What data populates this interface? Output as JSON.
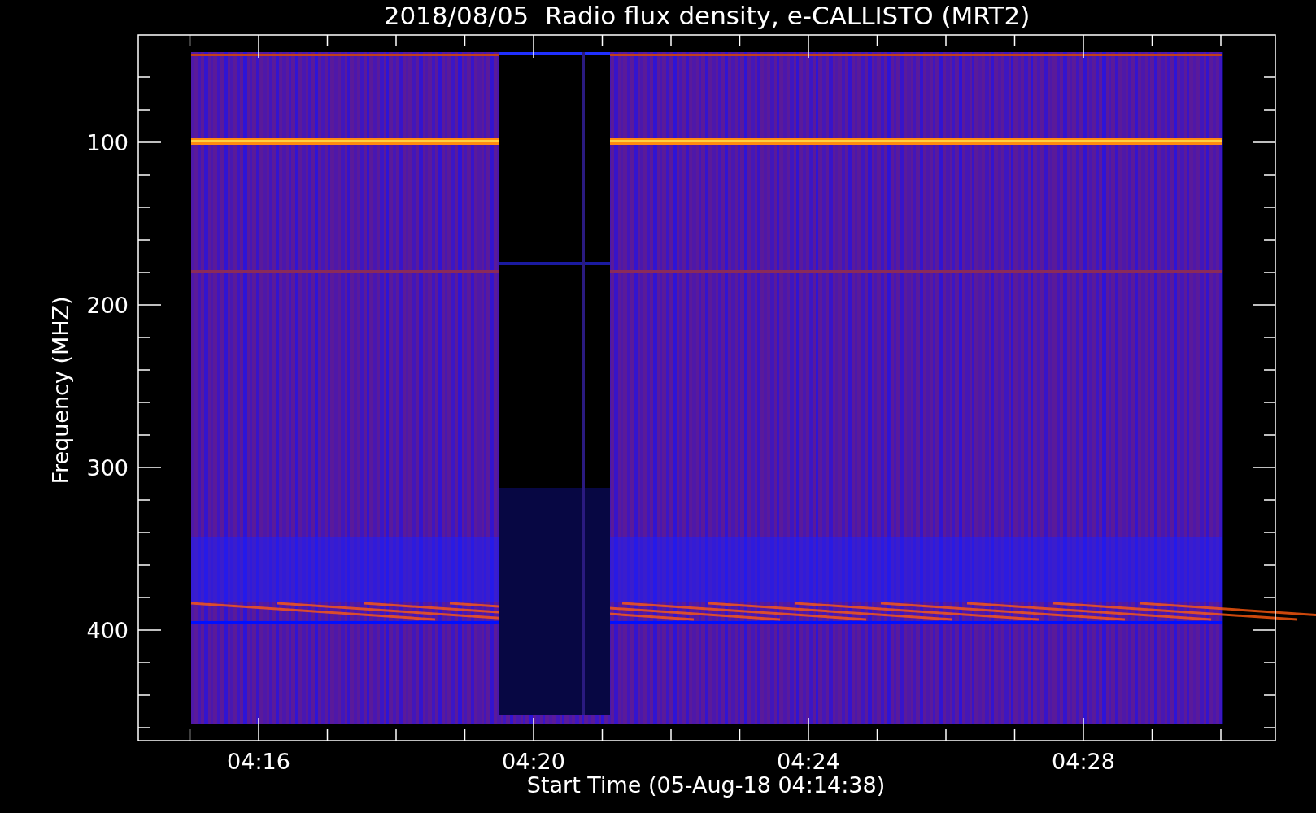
{
  "title": "2018/08/05  Radio flux density, e-CALLISTO (MRT2)",
  "y_axis": {
    "label": "Frequency (MHZ)",
    "ticks": [
      "100",
      "200",
      "300",
      "400"
    ]
  },
  "x_axis": {
    "label": "Start Time (05-Aug-18 04:14:38)",
    "ticks": [
      "04:16",
      "04:20",
      "04:24",
      "04:28"
    ]
  }
}
